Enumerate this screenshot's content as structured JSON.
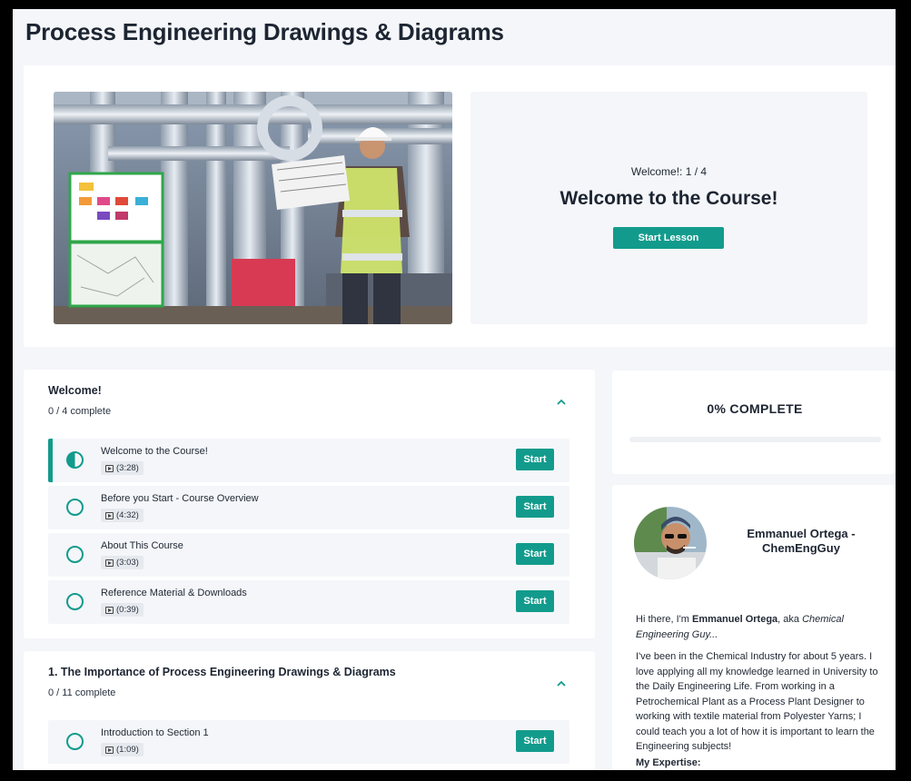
{
  "page": {
    "title": "Process Engineering Drawings & Diagrams"
  },
  "hero": {
    "subtitle": "Welcome!: 1 / 4",
    "heading": "Welcome to the Course!",
    "button": "Start Lesson"
  },
  "sections": [
    {
      "title": "Welcome!",
      "count": "0 / 4 complete",
      "lessons": [
        {
          "title": "Welcome to the Course!",
          "duration": "(3:28)",
          "button": "Start"
        },
        {
          "title": "Before you Start - Course Overview",
          "duration": "(4:32)",
          "button": "Start"
        },
        {
          "title": "About This Course",
          "duration": "(3:03)",
          "button": "Start"
        },
        {
          "title": "Reference Material & Downloads",
          "duration": "(0:39)",
          "button": "Start"
        }
      ]
    },
    {
      "title": "1. The Importance of Process Engineering Drawings & Diagrams",
      "count": "0 / 11 complete",
      "lessons": [
        {
          "title": "Introduction to Section 1",
          "duration": "(1:09)",
          "button": "Start"
        }
      ]
    }
  ],
  "progress": {
    "label": "0% COMPLETE",
    "value": 0
  },
  "author": {
    "name": "Emmanuel Ortega - ChemEngGuy",
    "intro_pre": "Hi there, I'm ",
    "intro_name": "Emmanuel Ortega",
    "intro_mid": ", aka ",
    "intro_alias": "Chemical Engineering Guy...",
    "paragraph": "I've been in the Chemical Industry for about 5 years. I love applying all my knowledge learned in University to the Daily Engineering Life. From working in a Petrochemical Plant as a Process Plant Designer to working with textile material from Polyester Yarns; I could teach you a lot of how it is important to learn the Engineering subjects!",
    "expertise_heading": "My Expertise:"
  },
  "colors": {
    "accent": "#129b8c",
    "panel": "#f4f6f9"
  }
}
